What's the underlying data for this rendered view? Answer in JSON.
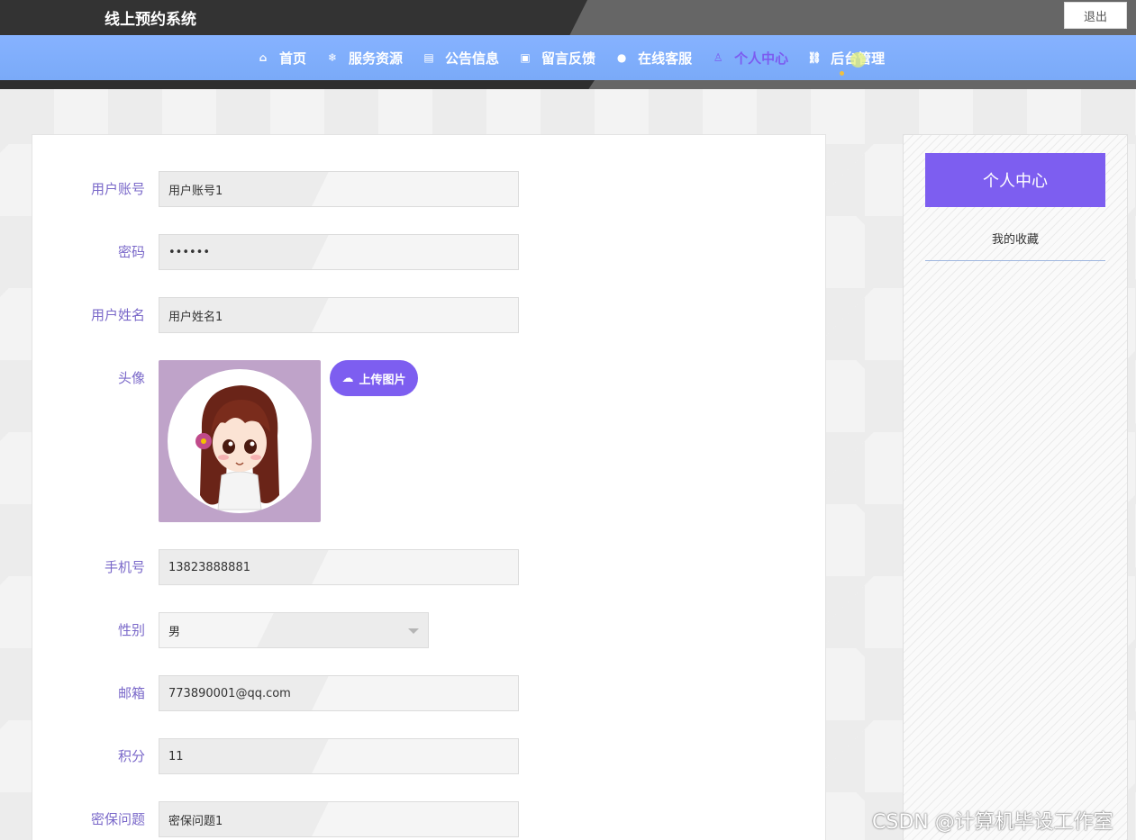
{
  "header": {
    "site_title": "线上预约系统",
    "logout_label": "退出"
  },
  "nav": {
    "items": [
      {
        "label": "首页",
        "icon": "home-icon",
        "glyph": "⌂"
      },
      {
        "label": "服务资源",
        "icon": "snowflake-icon",
        "glyph": "❄"
      },
      {
        "label": "公告信息",
        "icon": "clipboard-icon",
        "glyph": "▤"
      },
      {
        "label": "留言反馈",
        "icon": "gift-icon",
        "glyph": "▣"
      },
      {
        "label": "在线客服",
        "icon": "chat-icon",
        "glyph": "●"
      },
      {
        "label": "个人中心",
        "icon": "user-icon",
        "glyph": "♙"
      },
      {
        "label": "后台管理",
        "icon": "link-icon",
        "glyph": "⛓"
      }
    ],
    "active_index": 5
  },
  "form": {
    "account": {
      "label": "用户账号",
      "value": "用户账号1"
    },
    "password": {
      "label": "密码",
      "value": "••••••"
    },
    "name": {
      "label": "用户姓名",
      "value": "用户姓名1"
    },
    "avatar": {
      "label": "头像",
      "upload_label": "上传图片"
    },
    "phone": {
      "label": "手机号",
      "value": "13823888881"
    },
    "gender": {
      "label": "性别",
      "value": "男"
    },
    "email": {
      "label": "邮箱",
      "value": "773890001@qq.com"
    },
    "points": {
      "label": "积分",
      "value": "11"
    },
    "security_question": {
      "label": "密保问题",
      "value": "密保问题1"
    }
  },
  "sidebar": {
    "title": "个人中心",
    "links": [
      "我的收藏"
    ]
  },
  "watermark": "CSDN @计算机毕设工作室",
  "colors": {
    "accent": "#7d5ef0",
    "nav_bg": "#7aaaf8",
    "topbar_dark": "#333333",
    "topbar_light": "#666666",
    "label": "#7a68c9"
  }
}
